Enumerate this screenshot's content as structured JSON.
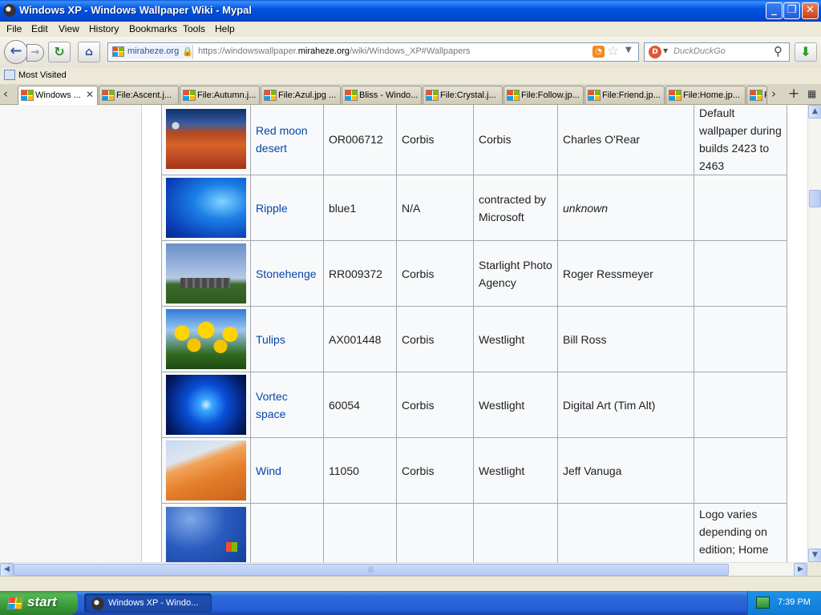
{
  "window": {
    "title": "Windows XP - Windows Wallpaper Wiki - Mypal"
  },
  "menu": [
    "File",
    "Edit",
    "View",
    "History",
    "Bookmarks",
    "Tools",
    "Help"
  ],
  "urlbar": {
    "site_name": "miraheze.org",
    "url_prefix": "https://windowswallpaper.",
    "url_domain": "miraheze.org",
    "url_suffix": "/wiki/Windows_XP#Wallpapers"
  },
  "search": {
    "placeholder": "DuckDuckGo"
  },
  "bookmarks": {
    "label": "Most Visited"
  },
  "tabs": [
    {
      "label": "Windows ...",
      "active": true
    },
    {
      "label": "File:Ascent.j..."
    },
    {
      "label": "File:Autumn.j..."
    },
    {
      "label": "File:Azul.jpg ..."
    },
    {
      "label": "Bliss - Windo..."
    },
    {
      "label": "File:Crystal.j..."
    },
    {
      "label": "File:Follow.jp..."
    },
    {
      "label": "File:Friend.jp..."
    },
    {
      "label": "File:Home.jp..."
    },
    {
      "label": "F"
    }
  ],
  "table": {
    "rows": [
      {
        "thumb": "red-moon-desert",
        "name": "Red moon desert",
        "id": "OR006712",
        "source": "Corbis",
        "agency": "Corbis",
        "author": "Charles O'Rear",
        "notes": "Default wallpaper during builds 2423 to 2463"
      },
      {
        "thumb": "ripple",
        "name": "Ripple",
        "id": "blue1",
        "source": "N/A",
        "agency": "contracted by Microsoft",
        "author": "unknown",
        "notes": ""
      },
      {
        "thumb": "stonehenge",
        "name": "Stonehenge",
        "id": "RR009372",
        "source": "Corbis",
        "agency": "Starlight Photo Agency",
        "author": "Roger Ressmeyer",
        "notes": ""
      },
      {
        "thumb": "tulips",
        "name": "Tulips",
        "id": "AX001448",
        "source": "Corbis",
        "agency": "Westlight",
        "author": "Bill Ross",
        "notes": ""
      },
      {
        "thumb": "vortec-space",
        "name": "Vortec space",
        "id": "60054",
        "source": "Corbis",
        "agency": "Westlight",
        "author": "Digital Art (Tim Alt)",
        "notes": ""
      },
      {
        "thumb": "wind",
        "name": "Wind",
        "id": "11050",
        "source": "Corbis",
        "agency": "Westlight",
        "author": "Jeff Vanuga",
        "notes": ""
      },
      {
        "thumb": "windows-logo",
        "name": "",
        "id": "",
        "source": "",
        "agency": "",
        "author": "",
        "notes": "Logo varies depending on edition; Home"
      }
    ]
  },
  "taskbar": {
    "start_label": "start",
    "task_label": "Windows XP - Windo...",
    "clock": "7:39 PM"
  }
}
